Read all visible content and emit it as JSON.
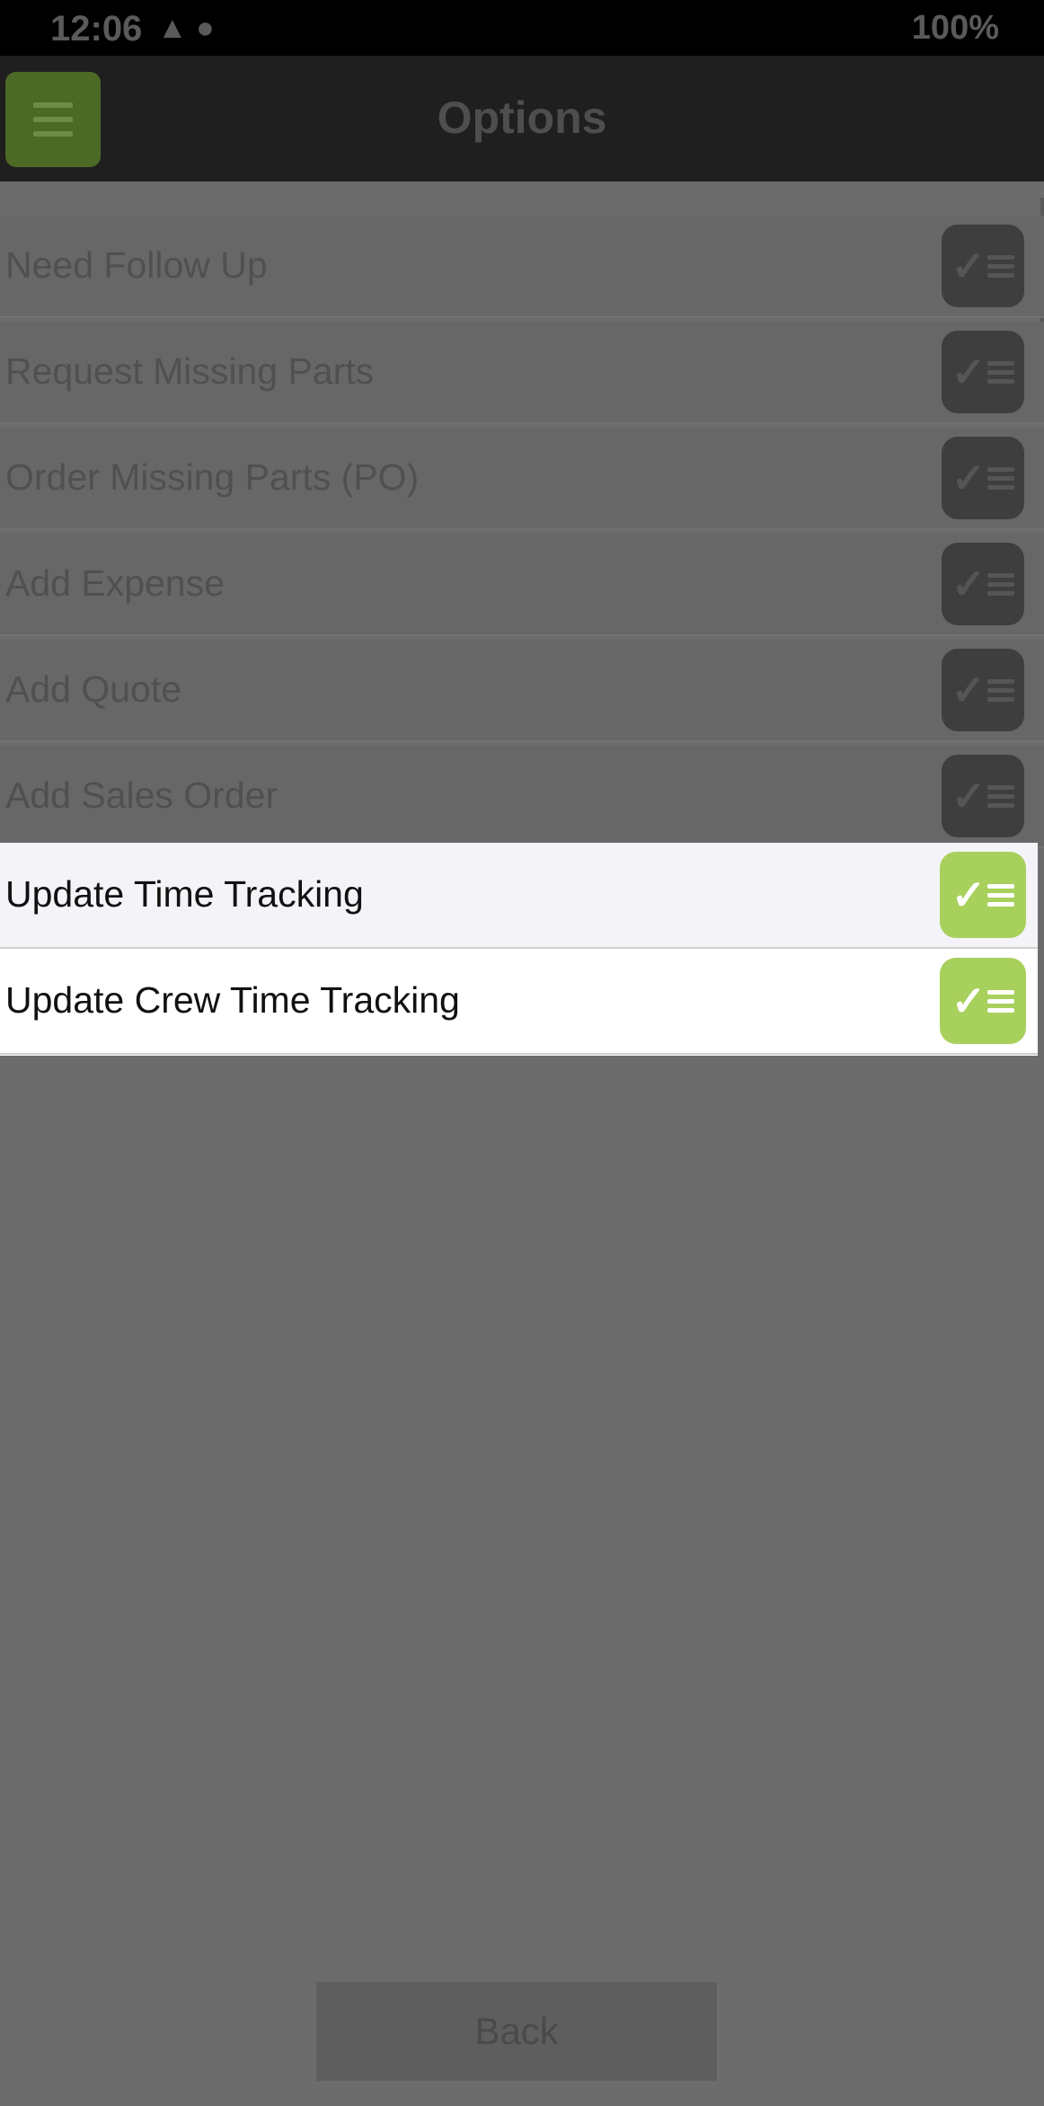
{
  "status_bar": {
    "time": "12:06",
    "left_icons": "▲ ●",
    "battery": "100%"
  },
  "header": {
    "title": "Options",
    "menu_icon": "hamburger-icon"
  },
  "options": [
    {
      "label": "Need Follow Up",
      "enabled": false
    },
    {
      "label": "Request Missing Parts",
      "enabled": false
    },
    {
      "label": "Order Missing Parts (PO)",
      "enabled": false
    },
    {
      "label": "Add Expense",
      "enabled": false
    },
    {
      "label": "Add Quote",
      "enabled": false
    },
    {
      "label": "Add Sales Order",
      "enabled": false
    },
    {
      "label": "Update Time Tracking",
      "enabled": true
    },
    {
      "label": "Update Crew Time Tracking",
      "enabled": true
    }
  ],
  "option_icon": "checklist-icon",
  "colors": {
    "accent": "#a8d05c",
    "overlay": "#6c6c6c"
  },
  "footer": {
    "back_label": "Back"
  }
}
